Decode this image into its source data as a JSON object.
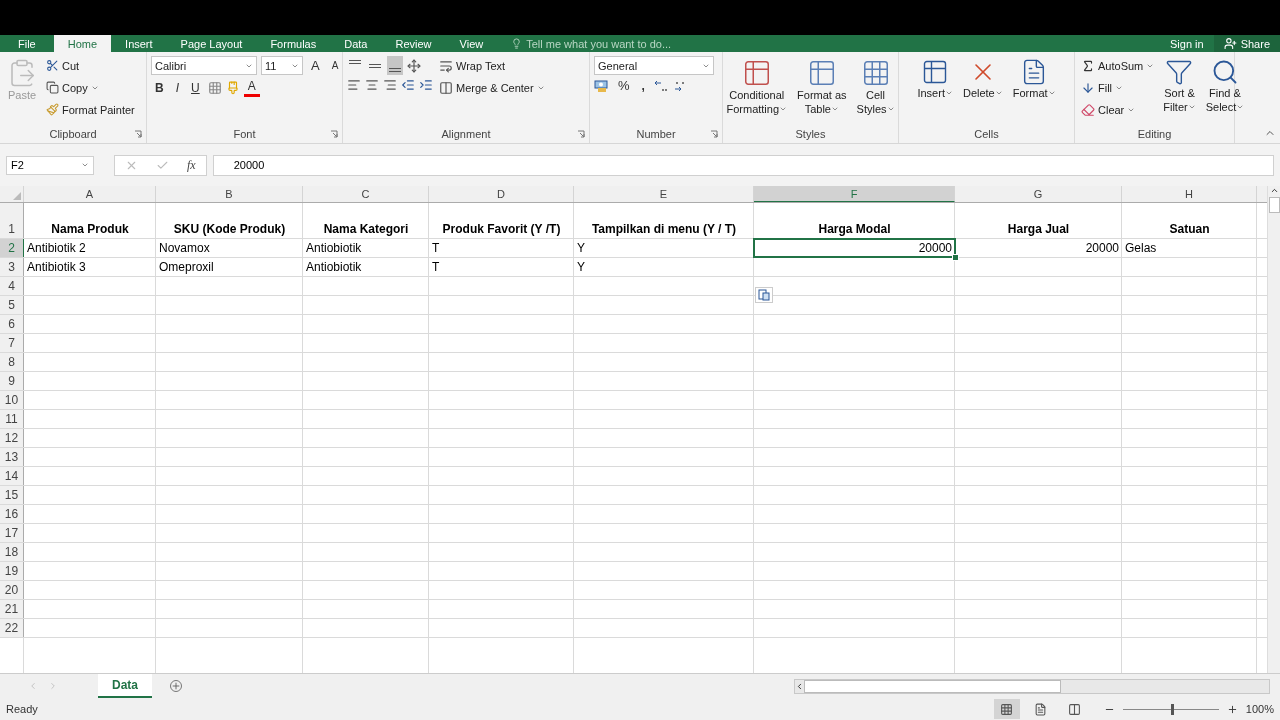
{
  "ribbon_tabs": [
    {
      "label": "File",
      "kind": "file",
      "selected": false
    },
    {
      "label": "Home",
      "kind": "tab",
      "selected": true
    },
    {
      "label": "Insert",
      "kind": "tab",
      "selected": false
    },
    {
      "label": "Page Layout",
      "kind": "tab",
      "selected": false
    },
    {
      "label": "Formulas",
      "kind": "tab",
      "selected": false
    },
    {
      "label": "Data",
      "kind": "tab",
      "selected": false
    },
    {
      "label": "Review",
      "kind": "tab",
      "selected": false
    },
    {
      "label": "View",
      "kind": "tab",
      "selected": false
    }
  ],
  "tell_me": {
    "placeholder": "Tell me what you want to do..."
  },
  "sign_in": "Sign in",
  "share": "Share",
  "ribbon": {
    "groups": [
      {
        "kind": "clipboard",
        "title": "Clipboard",
        "launcher": true,
        "paste": {
          "label": "Paste",
          "disabled": true
        },
        "cut": "Cut",
        "copy": "Copy",
        "format_painter": "Format Painter"
      },
      {
        "kind": "font",
        "title": "Font",
        "launcher": true,
        "font": "Calibri",
        "size": "11",
        "grow": "A",
        "shrink": "A",
        "bold": "B",
        "italic": "I",
        "underline": "U",
        "font_color": "A"
      },
      {
        "kind": "alignment",
        "title": "Alignment",
        "launcher": true,
        "vertical_align": [
          {
            "kind": "top",
            "selected": false
          },
          {
            "kind": "middle",
            "selected": false
          },
          {
            "kind": "bottom",
            "selected": true
          }
        ],
        "wrap_text": "Wrap Text",
        "merge": "Merge & Center"
      },
      {
        "kind": "number",
        "title": "Number",
        "launcher": true,
        "format": "General",
        "percent": "%",
        "comma": ","
      },
      {
        "kind": "large",
        "title": "Styles",
        "buttons": [
          {
            "kind": "conditional",
            "lines": [
              "Conditional",
              "Formatting"
            ]
          },
          {
            "kind": "table",
            "lines": [
              "Format as",
              "Table"
            ]
          },
          {
            "kind": "styles",
            "lines": [
              "Cell",
              "Styles"
            ]
          }
        ]
      },
      {
        "kind": "large",
        "title": "Cells",
        "buttons": [
          {
            "kind": "insert",
            "lines": [
              "Insert"
            ]
          },
          {
            "kind": "delete",
            "lines": [
              "Delete"
            ]
          },
          {
            "kind": "format",
            "lines": [
              "Format"
            ]
          }
        ]
      },
      {
        "kind": "editing",
        "title": "Editing",
        "autosum": "AutoSum",
        "fill": "Fill",
        "clear": "Clear",
        "buttons": [
          {
            "kind": "sort",
            "lines": [
              "Sort &",
              "Filter"
            ]
          },
          {
            "kind": "find",
            "lines": [
              "Find &",
              "Select"
            ]
          }
        ]
      }
    ]
  },
  "name_box": "F2",
  "function_label": "fx",
  "formula": "20000",
  "columns": [
    {
      "letter": "A",
      "selected": false
    },
    {
      "letter": "B",
      "selected": false
    },
    {
      "letter": "C",
      "selected": false
    },
    {
      "letter": "D",
      "selected": false
    },
    {
      "letter": "E",
      "selected": false
    },
    {
      "letter": "F",
      "selected": true
    },
    {
      "letter": "G",
      "selected": false
    },
    {
      "letter": "H",
      "selected": false
    }
  ],
  "rows": [
    {
      "number": "1",
      "kind": "header",
      "selected": false,
      "cells": {
        "A": {
          "text": "Nama Produk",
          "selected": false
        },
        "B": {
          "text": "SKU (Kode Produk)",
          "selected": false
        },
        "C": {
          "text": "Nama Kategori",
          "selected": false
        },
        "D": {
          "text": "Produk Favorit (Y /T)",
          "selected": false
        },
        "E": {
          "text": "Tampilkan di menu (Y / T)",
          "selected": false
        },
        "F": {
          "text": "Harga Modal",
          "selected": false
        },
        "G": {
          "text": "Harga Jual",
          "selected": false
        },
        "H": {
          "text": "Satuan",
          "selected": false
        }
      }
    },
    {
      "number": "2",
      "kind": "data",
      "selected": true,
      "cells": {
        "A": {
          "text": "Antibiotik 2",
          "selected": false
        },
        "B": {
          "text": "Novamox",
          "selected": false
        },
        "C": {
          "text": "Antiobiotik",
          "selected": false
        },
        "D": {
          "text": "T",
          "selected": false
        },
        "E": {
          "text": "Y",
          "selected": false
        },
        "F": {
          "text": "20000",
          "selected": true
        },
        "G": {
          "text": "20000",
          "selected": false
        },
        "H": {
          "text": "Gelas",
          "selected": false
        }
      }
    },
    {
      "number": "3",
      "kind": "data",
      "selected": false,
      "cells": {
        "A": {
          "text": "Antibiotik 3",
          "selected": false
        },
        "B": {
          "text": "Omeproxil",
          "selected": false
        },
        "C": {
          "text": "Antiobiotik",
          "selected": false
        },
        "D": {
          "text": "T",
          "selected": false
        },
        "E": {
          "text": "Y",
          "selected": false
        }
      }
    },
    {
      "number": "4",
      "kind": "data",
      "selected": false
    },
    {
      "number": "5",
      "kind": "data",
      "selected": false
    },
    {
      "number": "6",
      "kind": "data",
      "selected": false
    },
    {
      "number": "7",
      "kind": "data",
      "selected": false
    },
    {
      "number": "8",
      "kind": "data",
      "selected": false
    },
    {
      "number": "9",
      "kind": "data",
      "selected": false
    },
    {
      "number": "10",
      "kind": "data",
      "selected": false
    },
    {
      "number": "11",
      "kind": "data",
      "selected": false
    },
    {
      "number": "12",
      "kind": "data",
      "selected": false
    },
    {
      "number": "13",
      "kind": "data",
      "selected": false
    },
    {
      "number": "14",
      "kind": "data",
      "selected": false
    },
    {
      "number": "15",
      "kind": "data",
      "selected": false
    },
    {
      "number": "16",
      "kind": "data",
      "selected": false
    },
    {
      "number": "17",
      "kind": "data",
      "selected": false
    },
    {
      "number": "18",
      "kind": "data",
      "selected": false
    },
    {
      "number": "19",
      "kind": "data",
      "selected": false
    },
    {
      "number": "20",
      "kind": "data",
      "selected": false
    },
    {
      "number": "21",
      "kind": "data",
      "selected": false
    },
    {
      "number": "22",
      "kind": "data",
      "selected": false
    }
  ],
  "sheet_tabs": [
    {
      "label": "Data",
      "selected": true
    }
  ],
  "status": "Ready",
  "view_modes": [
    {
      "kind": "normal",
      "selected": true
    },
    {
      "kind": "page_layout",
      "selected": false
    },
    {
      "kind": "page_break",
      "selected": false
    }
  ],
  "zoom": {
    "level": 0.5,
    "reading": "100%"
  }
}
